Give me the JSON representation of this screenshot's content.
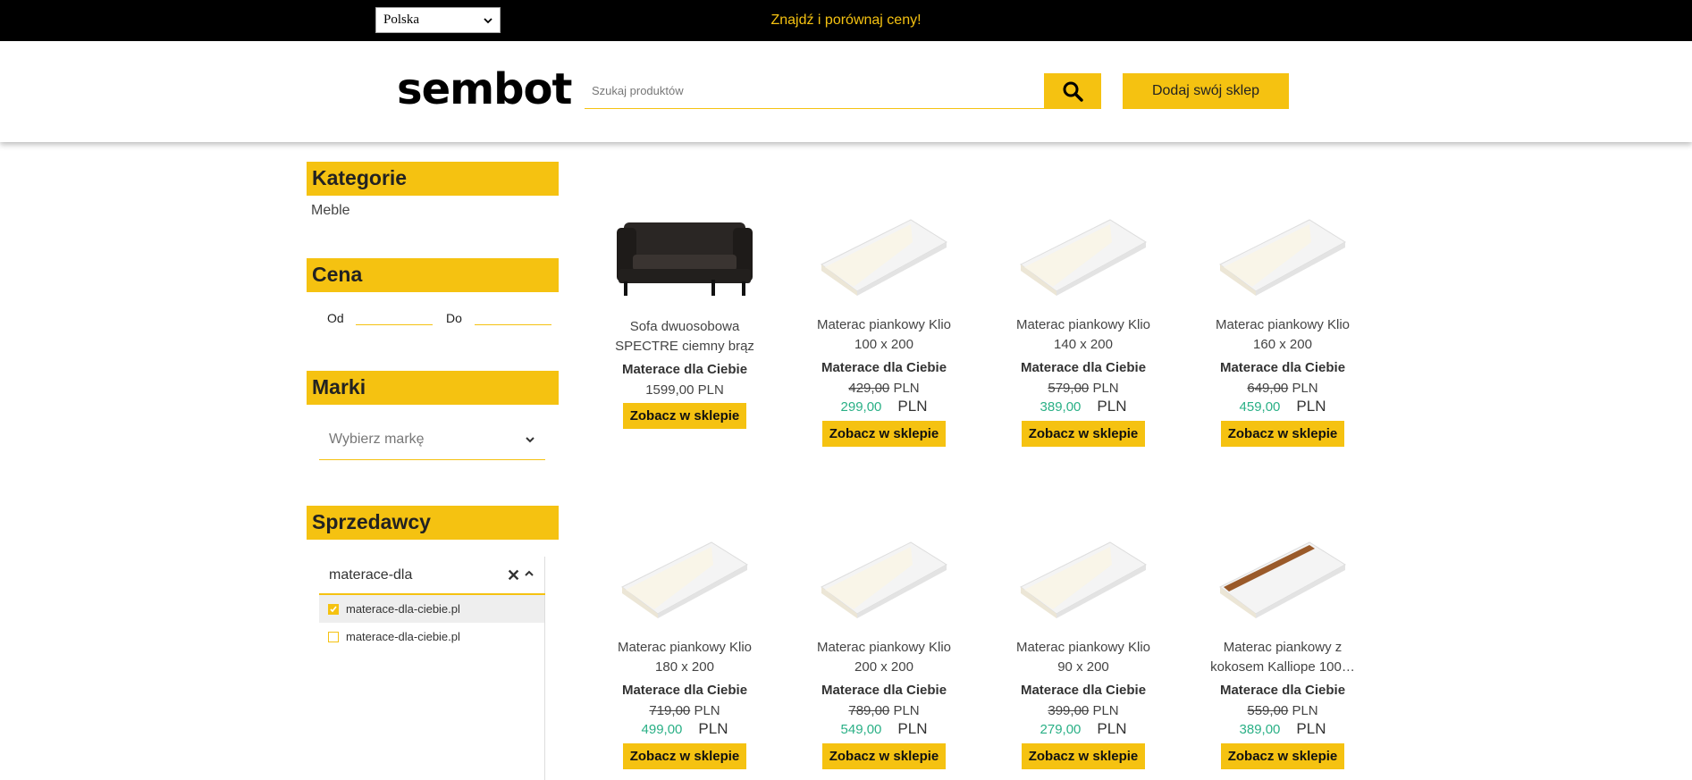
{
  "topbar": {
    "country": "Polska",
    "tagline": "Znajdź i porównaj ceny!"
  },
  "header": {
    "logo": "sembot",
    "search_placeholder": "Szukaj produktów",
    "add_shop_label": "Dodaj swój sklep"
  },
  "sidebar": {
    "categories": {
      "title": "Kategorie",
      "items": [
        "Meble"
      ]
    },
    "price": {
      "title": "Cena",
      "from_label": "Od",
      "to_label": "Do"
    },
    "brands": {
      "title": "Marki",
      "placeholder": "Wybierz markę"
    },
    "sellers": {
      "title": "Sprzedawcy",
      "query": "materace-dla",
      "options": [
        {
          "label": "materace-dla-ciebie.pl",
          "checked": true
        },
        {
          "label": "materace-dla-ciebie.pl",
          "checked": false
        }
      ]
    }
  },
  "products": [
    {
      "name": "Sofa dwuosobowa SPECTRE ciemny brąz",
      "shop": "Materace dla Ciebie",
      "price": "1599,00",
      "currency": "PLN",
      "image": "sofa",
      "cta": "Zobacz w sklepie"
    },
    {
      "name": "Materac piankowy Klio 100 x 200",
      "shop": "Materace dla Ciebie",
      "old_price": "429,00",
      "price": "299,00",
      "currency": "PLN",
      "image": "mattress",
      "cta": "Zobacz w sklepie"
    },
    {
      "name": "Materac piankowy Klio 140 x 200",
      "shop": "Materace dla Ciebie",
      "old_price": "579,00",
      "price": "389,00",
      "currency": "PLN",
      "image": "mattress",
      "cta": "Zobacz w sklepie"
    },
    {
      "name": "Materac piankowy Klio 160 x 200",
      "shop": "Materace dla Ciebie",
      "old_price": "649,00",
      "price": "459,00",
      "currency": "PLN",
      "image": "mattress",
      "cta": "Zobacz w sklepie"
    },
    {
      "name": "Materac piankowy Klio 180 x 200",
      "shop": "Materace dla Ciebie",
      "old_price": "719,00",
      "price": "499,00",
      "currency": "PLN",
      "image": "mattress",
      "cta": "Zobacz w sklepie"
    },
    {
      "name": "Materac piankowy Klio 200 x 200",
      "shop": "Materace dla Ciebie",
      "old_price": "789,00",
      "price": "549,00",
      "currency": "PLN",
      "image": "mattress",
      "cta": "Zobacz w sklepie"
    },
    {
      "name": "Materac piankowy Klio 90 x 200",
      "shop": "Materace dla Ciebie",
      "old_price": "399,00",
      "price": "279,00",
      "currency": "PLN",
      "image": "mattress",
      "cta": "Zobacz w sklepie"
    },
    {
      "name": "Materac piankowy z kokosem Kalliope 100…",
      "shop": "Materace dla Ciebie",
      "old_price": "559,00",
      "price": "389,00",
      "currency": "PLN",
      "image": "mattress-coconut",
      "cta": "Zobacz w sklepie"
    }
  ],
  "colors": {
    "accent": "#f5c211",
    "price_green": "#2ab086",
    "topbar": "#000000"
  }
}
